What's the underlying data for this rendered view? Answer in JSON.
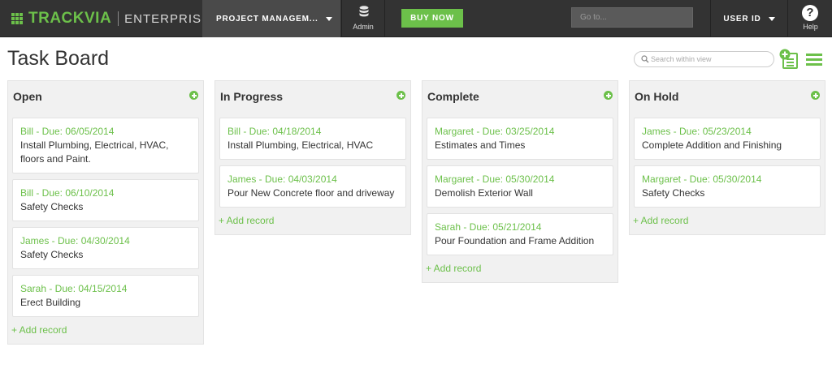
{
  "nav": {
    "brand": "TRACKVIA",
    "edition": "ENTERPRISE",
    "project_menu_label": "PROJECT MANAGEM...",
    "admin_label": "Admin",
    "admin_icon": "database-icon",
    "buy_now_label": "BUY NOW",
    "goto_placeholder": "Go to...",
    "user_label": "USER ID",
    "help_label": "Help",
    "help_icon": "question-circle-icon"
  },
  "page": {
    "title": "Task Board",
    "search_placeholder": "Search within view",
    "accent_color": "#6cc04a"
  },
  "columns": [
    {
      "title": "Open",
      "add_record_label": "+ Add record",
      "cards": [
        {
          "meta": "Bill - Due: 06/05/2014",
          "desc": "Install Plumbing, Electrical, HVAC, floors and Paint."
        },
        {
          "meta": "Bill - Due: 06/10/2014",
          "desc": "Safety Checks"
        },
        {
          "meta": "James - Due: 04/30/2014",
          "desc": "Safety Checks"
        },
        {
          "meta": "Sarah - Due: 04/15/2014",
          "desc": "Erect Building"
        }
      ]
    },
    {
      "title": "In Progress",
      "add_record_label": "+ Add record",
      "cards": [
        {
          "meta": "Bill - Due: 04/18/2014",
          "desc": "Install Plumbing, Electrical, HVAC"
        },
        {
          "meta": "James - Due: 04/03/2014",
          "desc": "Pour New Concrete floor and driveway"
        }
      ]
    },
    {
      "title": "Complete",
      "add_record_label": "+ Add record",
      "cards": [
        {
          "meta": "Margaret - Due: 03/25/2014",
          "desc": "Estimates and Times"
        },
        {
          "meta": "Margaret - Due: 05/30/2014",
          "desc": "Demolish Exterior Wall"
        },
        {
          "meta": "Sarah - Due: 05/21/2014",
          "desc": "Pour Foundation and Frame Addition"
        }
      ]
    },
    {
      "title": "On Hold",
      "add_record_label": "+ Add record",
      "cards": [
        {
          "meta": "James - Due: 05/23/2014",
          "desc": "Complete Addition and Finishing"
        },
        {
          "meta": "Margaret - Due: 05/30/2014",
          "desc": "Safety Checks"
        }
      ]
    }
  ]
}
